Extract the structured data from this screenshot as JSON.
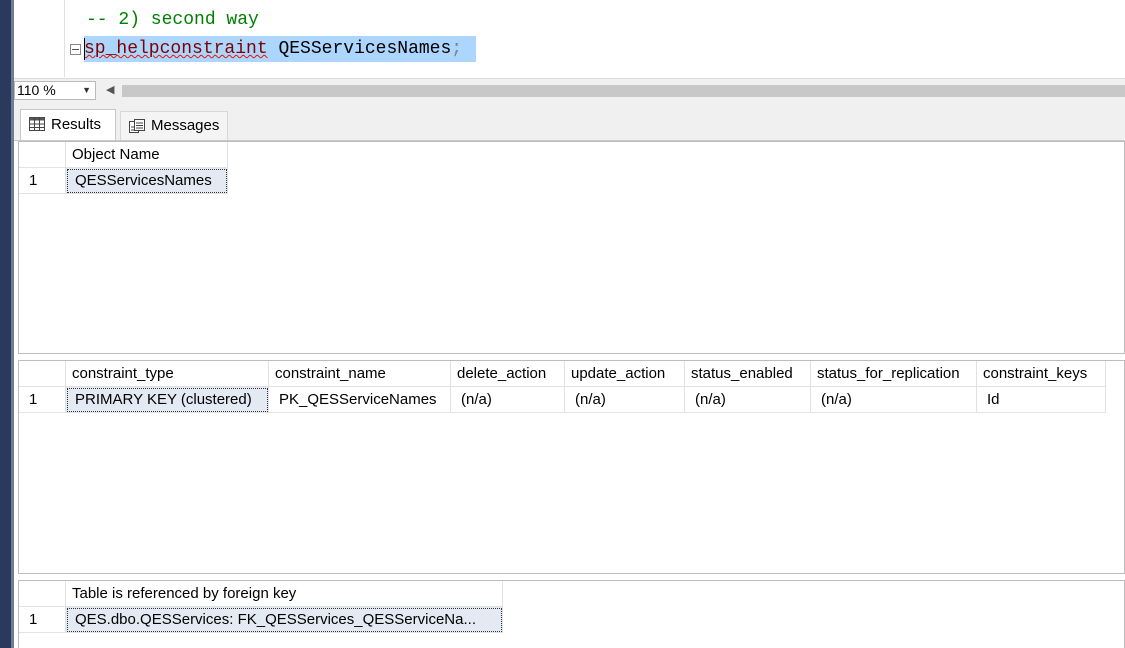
{
  "editor": {
    "comment_line": "-- 2) second way",
    "proc_name": "sp_helpconstraint",
    "table_arg": "QESServicesNames",
    "terminator": ";"
  },
  "zoom": {
    "value": "110 %"
  },
  "tabs": {
    "results": "Results",
    "messages": "Messages"
  },
  "grid1": {
    "headers": [
      "Object Name"
    ],
    "rows": [
      {
        "num": "1",
        "cells": [
          "QESServicesNames"
        ]
      }
    ]
  },
  "grid2": {
    "headers": [
      "constraint_type",
      "constraint_name",
      "delete_action",
      "update_action",
      "status_enabled",
      "status_for_replication",
      "constraint_keys"
    ],
    "rows": [
      {
        "num": "1",
        "cells": [
          "PRIMARY KEY (clustered)",
          "PK_QESServiceNames",
          "(n/a)",
          "(n/a)",
          "(n/a)",
          "(n/a)",
          "Id"
        ]
      }
    ]
  },
  "grid3": {
    "headers": [
      "Table is referenced by foreign key"
    ],
    "rows": [
      {
        "num": "1",
        "cells": [
          "QES.dbo.QESServices: FK_QESServices_QESServiceNa..."
        ]
      }
    ]
  }
}
